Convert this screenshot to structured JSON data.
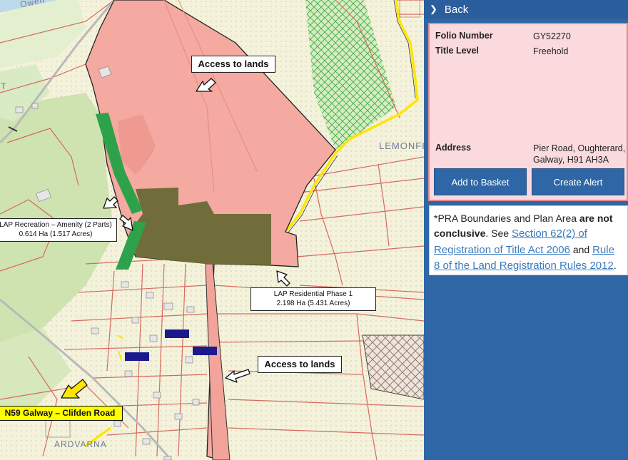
{
  "map": {
    "callouts": {
      "access_top": "Access to lands",
      "access_bottom": "Access to lands",
      "recreation": "LAP Recreation – Amenity (2 Parts)",
      "recreation_area": "0.614 Ha (1.517 Acres)",
      "residential": "LAP Residential Phase 1",
      "residential_area": "2.198 Ha (5.431 Acres)",
      "road": "N59 Galway – Clifden Road"
    },
    "places": {
      "lemonfield": "LEMONFI",
      "ardvarna": "ARDVARNA",
      "owen": "Owen",
      "t": "T"
    },
    "colors": {
      "site_pink": "#f4a9a1",
      "residential_olive": "#716d3a",
      "recreation_green": "#2ea24a",
      "field_green": "#d2e6b5",
      "blue_marker": "#1a1a8c",
      "yellow_road": "#ffe600"
    }
  },
  "panel": {
    "back_label": "Back",
    "folio_key": "Folio Number",
    "folio_value": "GY52270",
    "title_key": "Title Level",
    "title_value": "Freehold",
    "address_key": "Address",
    "address_value": "Pier Road, Oughterard, Galway, H91 AH3A",
    "add_basket": "Add to Basket",
    "create_alert": "Create Alert",
    "notice": {
      "prefix": "*PRA Boundaries and Plan Area ",
      "bold": "are not conclusive",
      "mid": ". See ",
      "link1": "Section 62(2) of Registration of Title Act 2006",
      "and": " and ",
      "link2": "Rule 8 of the Land Registration Rules 2012",
      "end": "."
    }
  }
}
